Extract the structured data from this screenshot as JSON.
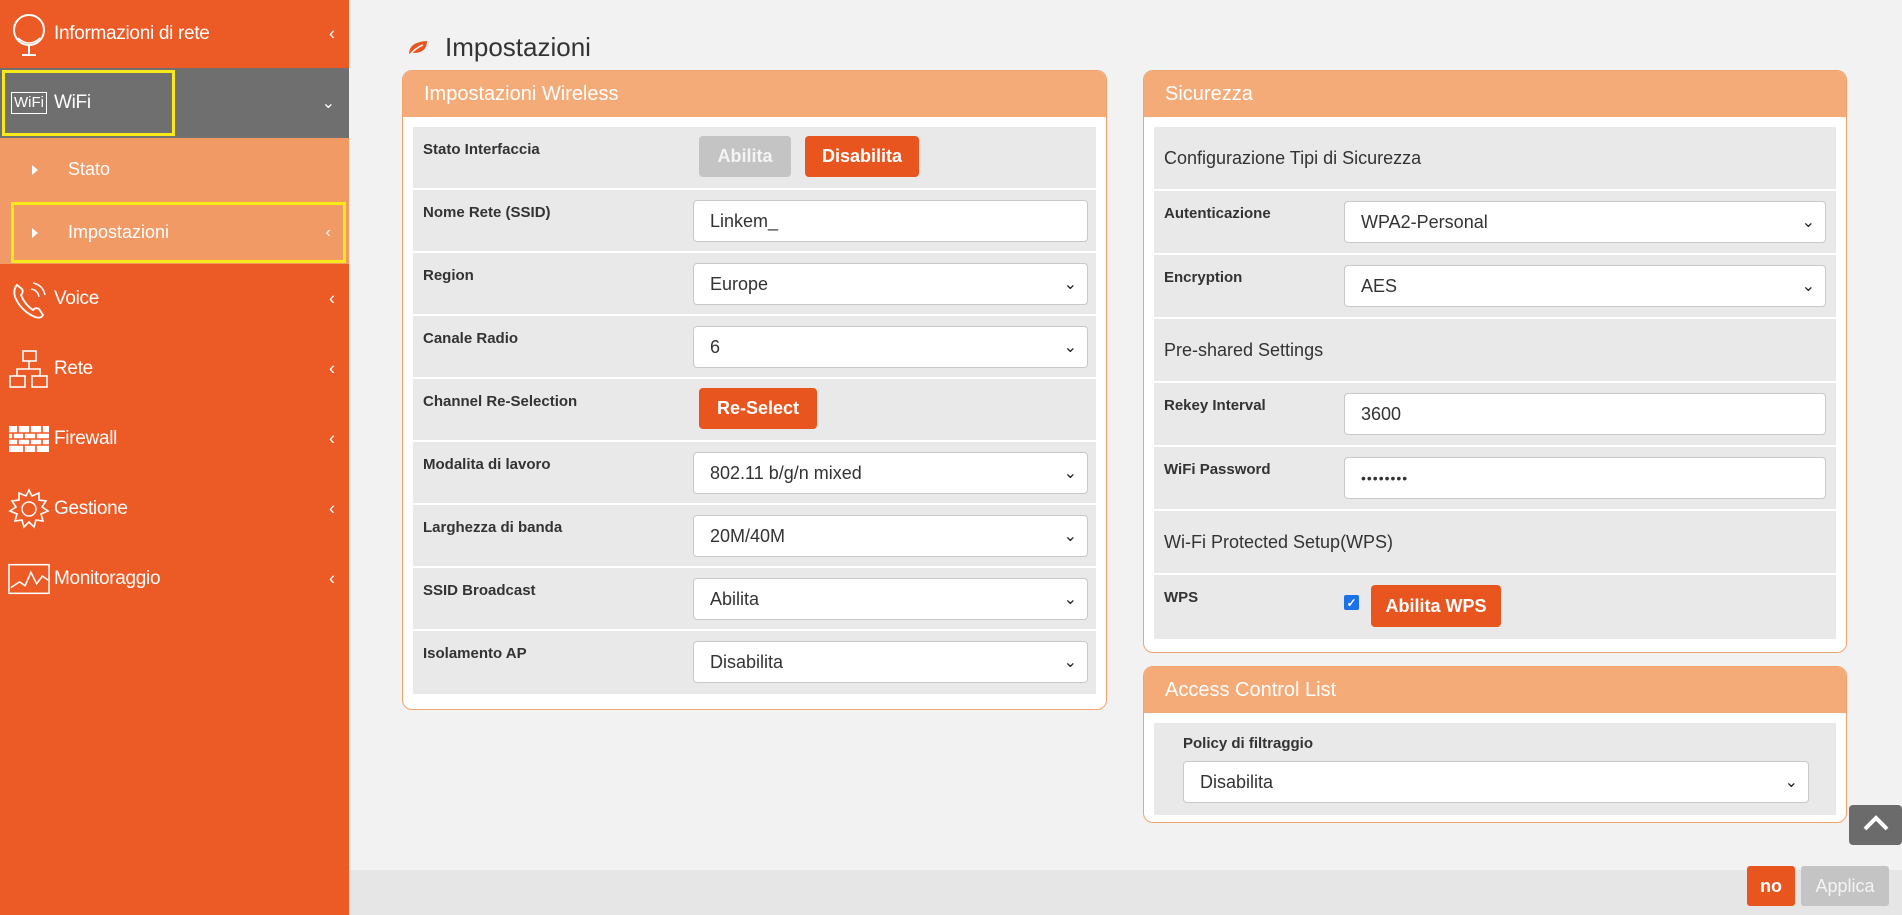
{
  "sidebar": {
    "items": [
      {
        "label": "Informazioni di rete",
        "icon": "globe-icon"
      },
      {
        "label": "WiFi",
        "icon": "wifi-icon",
        "icon_text": "WiFi"
      },
      {
        "label": "Voice",
        "icon": "phone-icon"
      },
      {
        "label": "Rete",
        "icon": "network-icon"
      },
      {
        "label": "Firewall",
        "icon": "firewall-icon"
      },
      {
        "label": "Gestione",
        "icon": "gear-icon"
      },
      {
        "label": "Monitoraggio",
        "icon": "monitor-chart-icon"
      }
    ],
    "submenu": [
      {
        "label": "Stato"
      },
      {
        "label": "Impostazioni"
      }
    ]
  },
  "page": {
    "title": "Impostazioni"
  },
  "wireless": {
    "title": "Impostazioni Wireless",
    "stato_label": "Stato Interfaccia",
    "enable_label": "Abilita",
    "disable_label": "Disabilita",
    "ssid_label": "Nome Rete (SSID)",
    "ssid_value": "Linkem_",
    "region_label": "Region",
    "region_value": "Europe",
    "channel_label": "Canale Radio",
    "channel_value": "6",
    "reselect_label": "Channel Re-Selection",
    "reselect_button": "Re-Select",
    "mode_label": "Modalita di lavoro",
    "mode_value": "802.11 b/g/n mixed",
    "bandwidth_label": "Larghezza di banda",
    "bandwidth_value": "20M/40M",
    "broadcast_label": "SSID Broadcast",
    "broadcast_value": "Abilita",
    "isolation_label": "Isolamento AP",
    "isolation_value": "Disabilita"
  },
  "security": {
    "title": "Sicurezza",
    "config_heading": "Configurazione Tipi di Sicurezza",
    "auth_label": "Autenticazione",
    "auth_value": "WPA2-Personal",
    "encryption_label": "Encryption",
    "encryption_value": "AES",
    "preshared_heading": "Pre-shared Settings",
    "rekey_label": "Rekey Interval",
    "rekey_value": "3600",
    "password_label": "WiFi Password",
    "password_value": "••••••••",
    "wps_heading": "Wi-Fi Protected Setup(WPS)",
    "wps_label": "WPS",
    "wps_checked": "✓",
    "wps_button": "Abilita WPS"
  },
  "acl": {
    "title": "Access Control List",
    "policy_label": "Policy di filtraggio",
    "policy_value": "Disabilita"
  },
  "footer": {
    "no_label": "no",
    "apply_label": "Applica"
  },
  "colors": {
    "sidebar": "#ec5a25",
    "accent": "#e8551f",
    "panel_header": "#f4ab78",
    "highlight": "#f7ea18"
  }
}
